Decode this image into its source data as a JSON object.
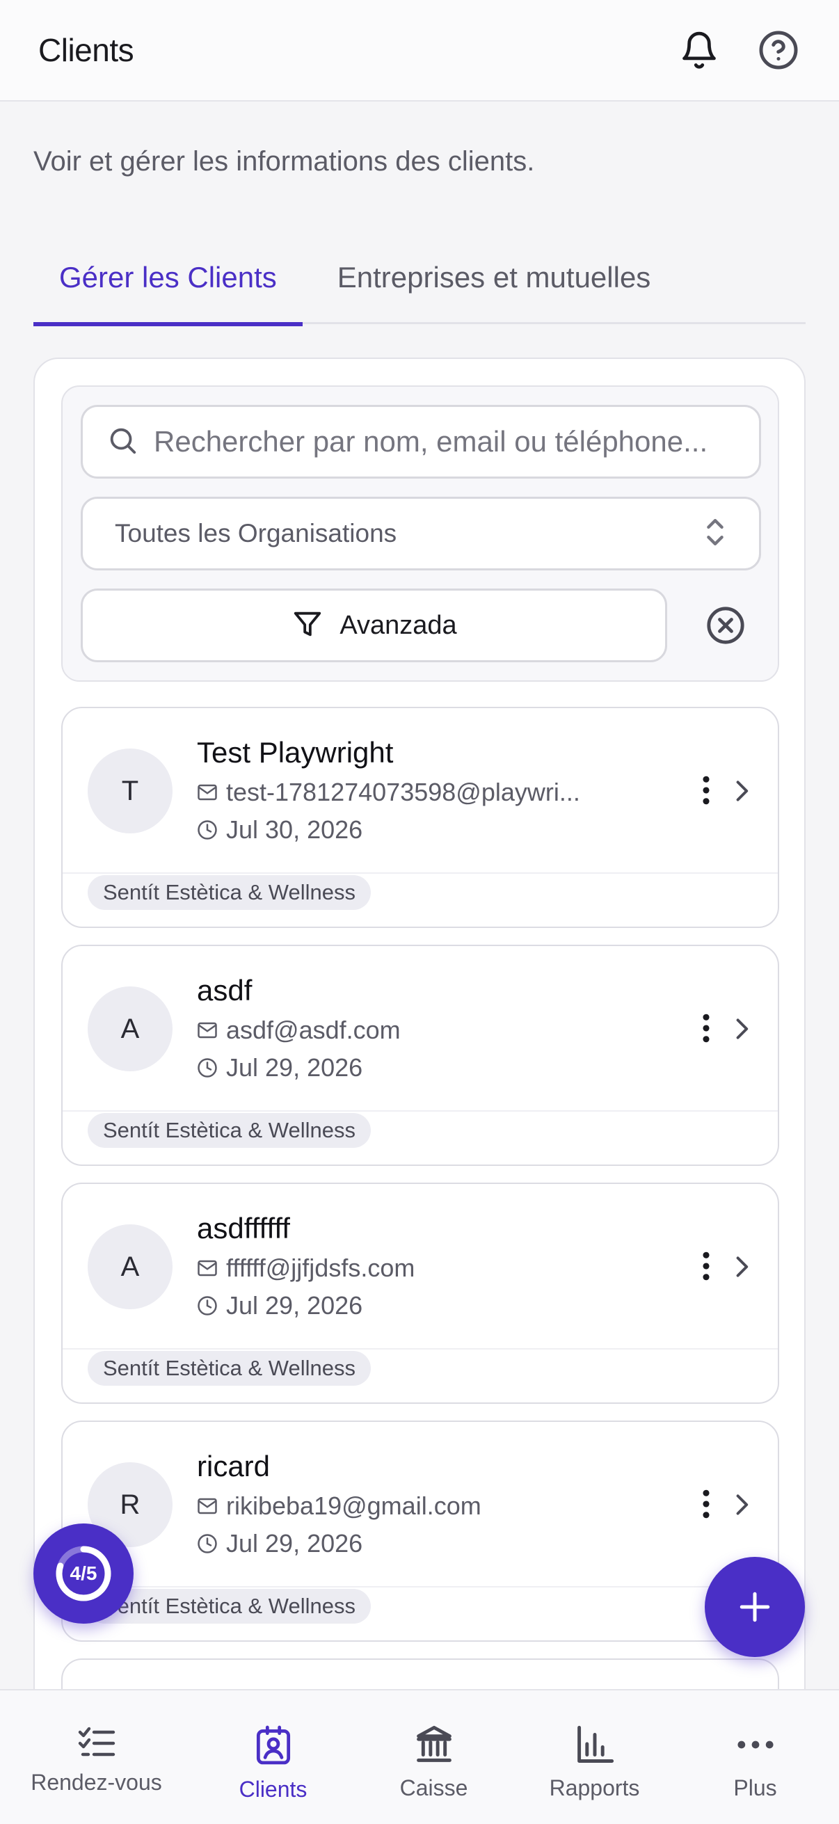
{
  "header": {
    "title": "Clients"
  },
  "page": {
    "subtitle": "Voir et gérer les informations des clients."
  },
  "tabs": [
    {
      "label": "Gérer les Clients",
      "active": true
    },
    {
      "label": "Entreprises et mutuelles",
      "active": false
    }
  ],
  "filters": {
    "search_placeholder": "Rechercher par nom, email ou téléphone...",
    "organisation_value": "Toutes les Organisations",
    "advanced_label": "Avanzada"
  },
  "clients": [
    {
      "initial": "T",
      "name": "Test Playwright",
      "email": "test-1781274073598@playwri...",
      "date": "Jul 30, 2026",
      "org": "Sentít Estètica & Wellness"
    },
    {
      "initial": "A",
      "name": "asdf",
      "email": "asdf@asdf.com",
      "date": "Jul 29, 2026",
      "org": "Sentít Estètica & Wellness"
    },
    {
      "initial": "A",
      "name": "asdffffff",
      "email": "ffffff@jjfjdsfs.com",
      "date": "Jul 29, 2026",
      "org": "Sentít Estètica & Wellness"
    },
    {
      "initial": "R",
      "name": "ricard",
      "email": "rikibeba19@gmail.com",
      "date": "Jul 29, 2026",
      "org": "Sentít Estètica & Wellness"
    }
  ],
  "progress": {
    "label": "4/5",
    "fraction": 0.8
  },
  "bottom_nav": [
    {
      "label": "Rendez-vous",
      "icon": "checklist-icon",
      "active": false
    },
    {
      "label": "Clients",
      "icon": "client-card-icon",
      "active": true
    },
    {
      "label": "Caisse",
      "icon": "bank-icon",
      "active": false
    },
    {
      "label": "Rapports",
      "icon": "bar-chart-icon",
      "active": false
    },
    {
      "label": "Plus",
      "icon": "more-horizontal-icon",
      "active": false
    }
  ],
  "colors": {
    "accent": "#4a2fc6",
    "text_muted": "#5b5b66",
    "background": "#f5f5f7"
  }
}
